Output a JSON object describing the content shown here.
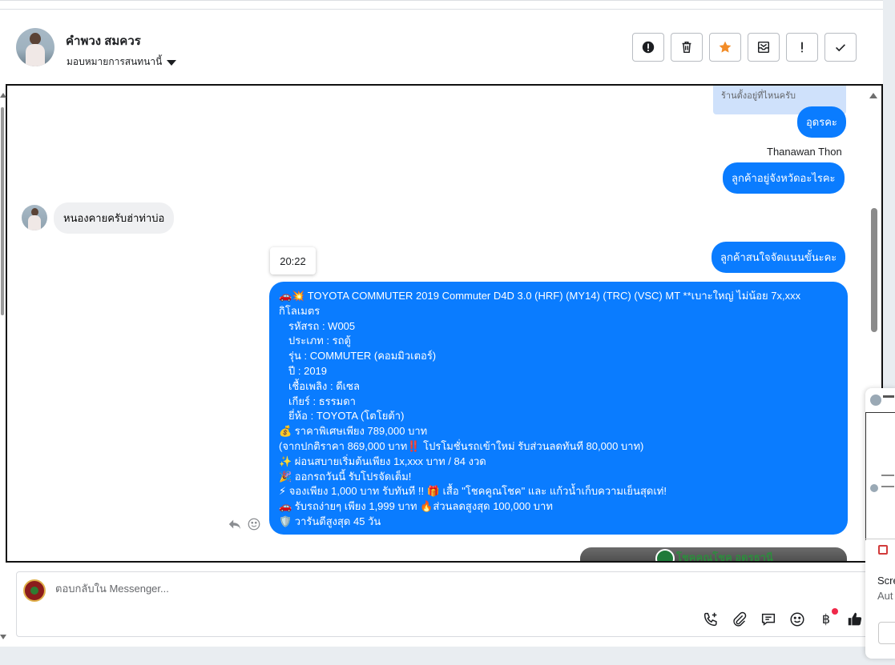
{
  "header": {
    "customer_name": "คำพวง สมควร",
    "assign_label": "มอบหมายการสนทนานี้",
    "actions": [
      {
        "icon": "alert-circle-icon",
        "glyph": "!"
      },
      {
        "icon": "trash-icon",
        "glyph": "🗑"
      },
      {
        "icon": "star-icon",
        "glyph": "★"
      },
      {
        "icon": "mail-archive-icon",
        "glyph": "✉"
      },
      {
        "icon": "exclamation-icon",
        "glyph": "!"
      },
      {
        "icon": "check-icon",
        "glyph": "✓"
      }
    ]
  },
  "thread": {
    "quoted_text": "ร้านตั้งอยู่ที่ไหนครับ",
    "msg_udon": "อุดรคะ",
    "sender_name": "Thanawan Thon",
    "msg_province": "ลูกค้าอยู่จังหวัดอะไรคะ",
    "msg_incoming": "หนองคายครับฮ่าท่าบ่อ",
    "msg_interest": "ลูกค้าสนใจจัดแนนขั้นะคะ",
    "time_chip": "20:22",
    "long_message": {
      "line1": "🚗💥 TOYOTA COMMUTER 2019 Commuter D4D 3.0 (HRF) (MY14) (TRC) (VSC) MT **เบาะใหญ่ ไม่น้อย 7x,xxx",
      "line2": "กิโลเมตร",
      "line3": "รหัสรถ : W005",
      "line4": "ประเภท : รถตู้",
      "line5": "รุ่น : COMMUTER (คอมมิวเตอร์)",
      "line6": "ปี : 2019",
      "line7": "เชื้อเพลิง : ดีเซล",
      "line8": "เกียร์ : ธรรมดา",
      "line9": "ยี่ห้อ : TOYOTA (โตโยต้า)",
      "line10": "💰 ราคาพิเศษเพียง 789,000 บาท",
      "line11": "(จากปกติราคา 869,000 บาท‼️ โปรโมชั่นรถเข้าใหม่ รับส่วนลดทันที 80,000 บาท)",
      "line12": "✨ ผ่อนสบายเริ่มต้นเพียง 1x,xxx บาท / 84 งวด",
      "line13": "🎉 ออกรถวันนี้ รับโปรจัดเต็ม!",
      "line14": "⚡ จองเพียง 1,000 บาท รับทันที !! 🎁 เสื้อ \"โชคคูณโชค\" และ แก้วน้ำเก็บความเย็นสุดเท่!",
      "line15": "🚗 รับรถง่ายๆ เพียง 1,999 บาท 🔥ส่วนลดสูงสุด 100,000 บาท",
      "line16": "🛡️ วารันตีสูงสุด 45 วัน"
    },
    "image_caption": "โชคคูณโชค อุดรธานี"
  },
  "composer": {
    "placeholder": "ตอบกลับใน Messenger...",
    "tools": [
      "phone-plus-icon",
      "paperclip-icon",
      "chat-bubble-icon",
      "smile-icon",
      "baht-icon",
      "thumbs-up-icon"
    ],
    "baht_glyph": "฿"
  },
  "side_panel": {
    "title": "Scre",
    "subtitle": "Aut"
  },
  "colors": {
    "outgoing": "#0a7cff",
    "incoming": "#eff0f2",
    "star": "#f28c28"
  }
}
